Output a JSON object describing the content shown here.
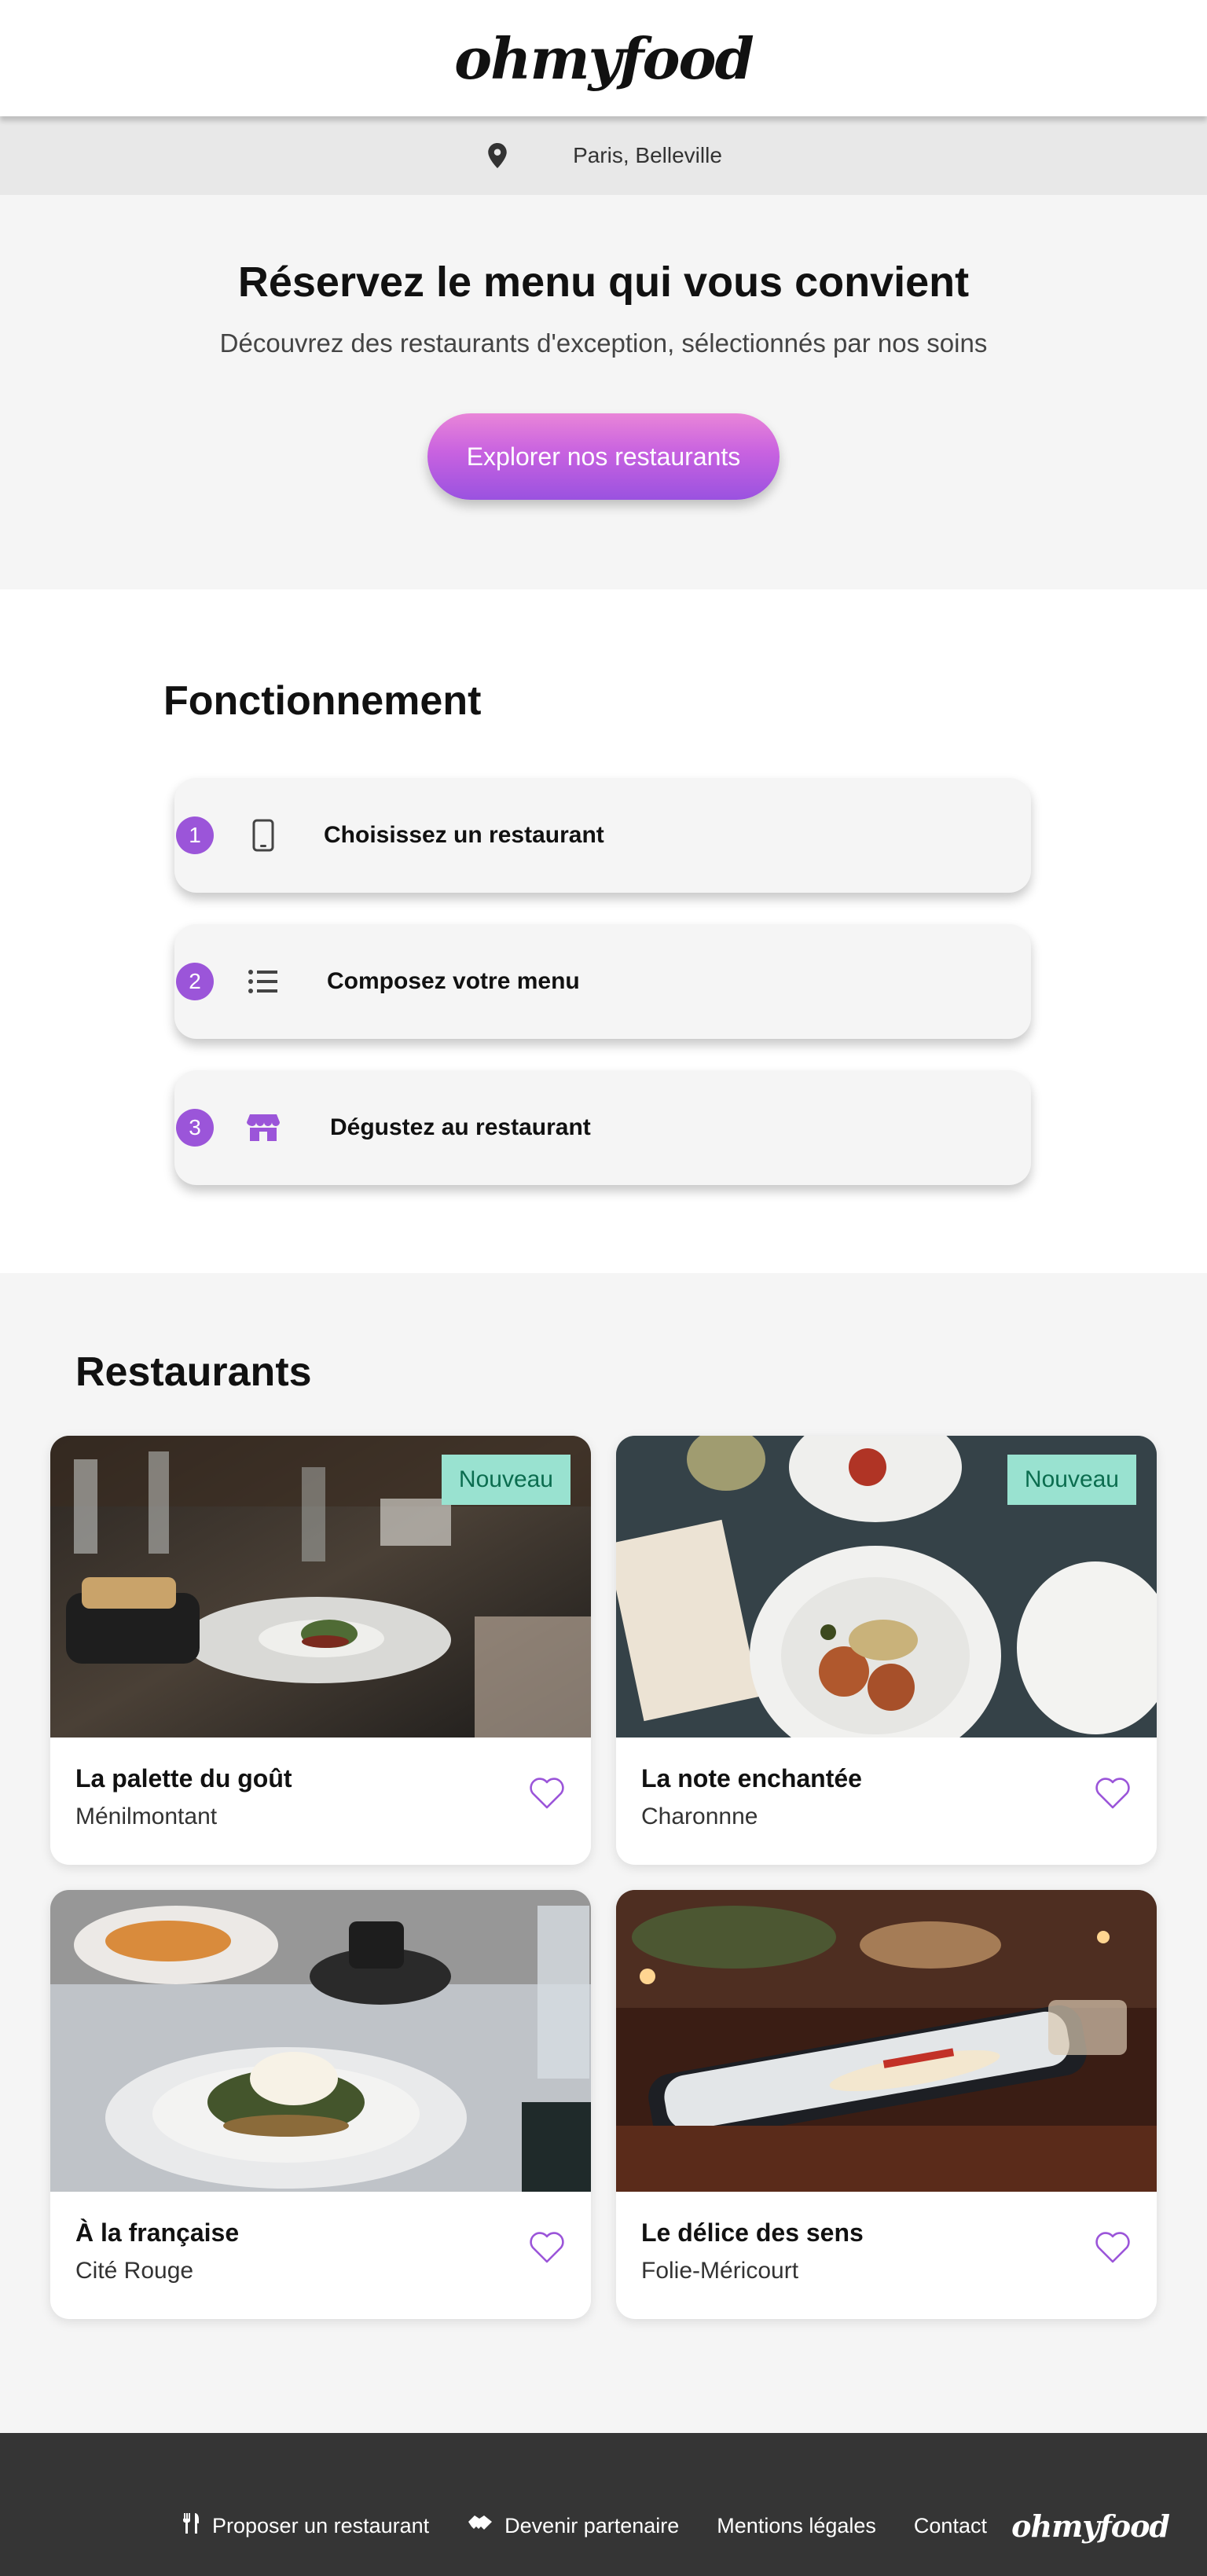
{
  "header": {
    "logo": "ohmyfood"
  },
  "location": {
    "icon": "location-pin-icon",
    "text": "Paris, Belleville"
  },
  "hero": {
    "title": "Réservez le menu qui vous convient",
    "subtitle": "Découvrez des restaurants d'exception, sélectionnés par nos soins",
    "cta_label": "Explorer nos restaurants"
  },
  "how": {
    "title": "Fonctionnement",
    "steps": [
      {
        "number": "1",
        "icon": "smartphone-icon",
        "label": "Choisissez un restaurant"
      },
      {
        "number": "2",
        "icon": "list-icon",
        "label": "Composez votre menu"
      },
      {
        "number": "3",
        "icon": "store-icon",
        "label": "Dégustez au restaurant"
      }
    ]
  },
  "restaurants": {
    "title": "Restaurants",
    "items": [
      {
        "name": "La palette du goût",
        "area": "Ménilmontant",
        "badge": "Nouveau"
      },
      {
        "name": "La note enchantée",
        "area": "Charonnne",
        "badge": "Nouveau"
      },
      {
        "name": "À la française",
        "area": "Cité Rouge"
      },
      {
        "name": "Le délice des sens",
        "area": "Folie-Méricourt"
      }
    ]
  },
  "footer": {
    "links": [
      {
        "icon": "fork-knife-icon",
        "label": "Proposer un restaurant"
      },
      {
        "icon": "handshake-icon",
        "label": "Devenir partenaire"
      },
      {
        "label": "Mentions légales"
      },
      {
        "label": "Contact"
      }
    ],
    "logo": "ohmyfood"
  },
  "colors": {
    "accent": "#9b55d9",
    "badge_bg": "#99e2d0",
    "badge_text": "#0b6d4f",
    "footer_bg": "#353535"
  }
}
